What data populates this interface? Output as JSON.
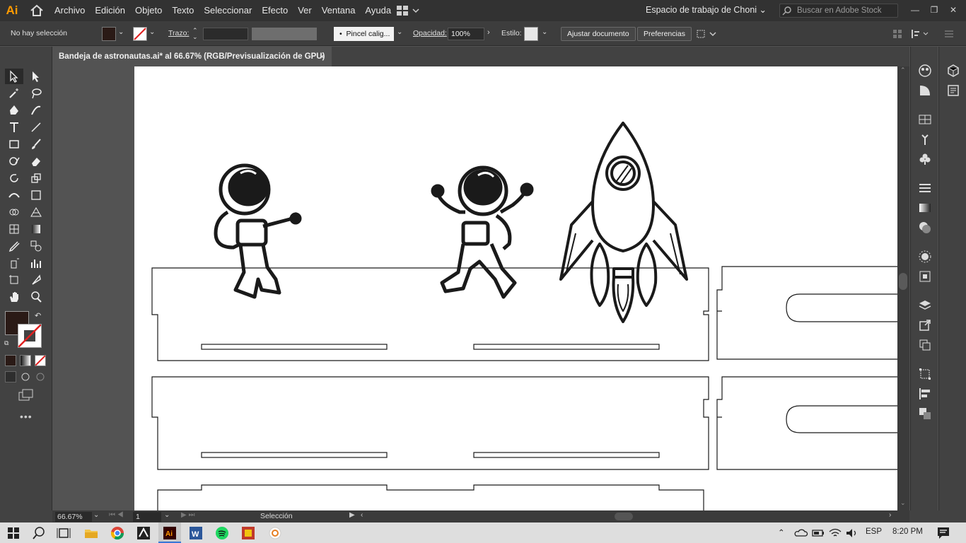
{
  "app": {
    "logo": "Ai"
  },
  "menu": [
    "Archivo",
    "Edición",
    "Objeto",
    "Texto",
    "Seleccionar",
    "Efecto",
    "Ver",
    "Ventana",
    "Ayuda"
  ],
  "workspace": "Espacio de trabajo de Choni",
  "stock_search": {
    "placeholder": "Buscar en Adobe Stock"
  },
  "control": {
    "selection": "No hay selección",
    "stroke_label": "Trazo:",
    "brush": "Pincel calig...",
    "opacity_label": "Opacidad:",
    "opacity_value": "100%",
    "style_label": "Estilo:",
    "fit_doc": "Ajustar documento",
    "prefs": "Preferencias"
  },
  "tab": {
    "title": "Bandeja de astronautas.ai* al 66.67% (RGB/Previsualización de GPU)",
    "close": "×"
  },
  "status": {
    "zoom": "66.67%",
    "page": "1",
    "tool": "Selección"
  },
  "taskbar": {
    "lang": "ESP",
    "time": "8:20 PM"
  },
  "colors": {
    "fill": "#2a1a16",
    "brand": "#ff9a00"
  }
}
